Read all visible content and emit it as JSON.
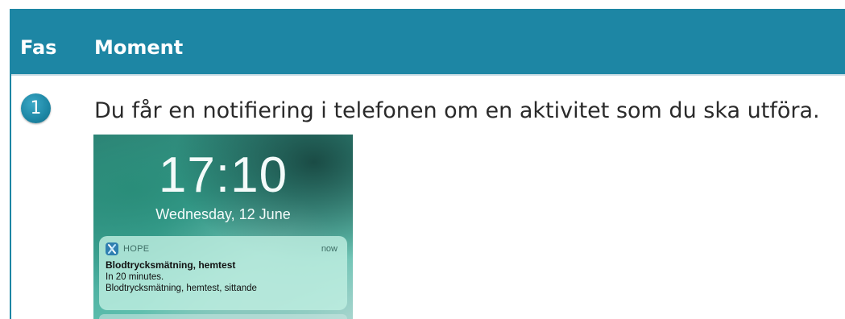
{
  "table": {
    "header": {
      "col_fas": "Fas",
      "col_moment": "Moment"
    },
    "rows": [
      {
        "step_number": "1",
        "description": "Du får en notifiering i telefonen om en aktivitet som du ska utföra.",
        "screenshot": {
          "clock": "17:10",
          "date": "Wednesday, 12 June",
          "notification": {
            "app_icon": "hope-app-icon",
            "app_name": "HOPE",
            "time": "now",
            "title": "Blodtrycksmätning, hemtest",
            "line1": "In 20 minutes.",
            "line2": "Blodtrycksmätning, hemtest, sittande"
          }
        }
      }
    ]
  },
  "colors": {
    "header_background": "#1d86a4",
    "header_text": "#ffffff",
    "step_circle": "#1d86a4",
    "body_text": "#2a2a2a"
  }
}
